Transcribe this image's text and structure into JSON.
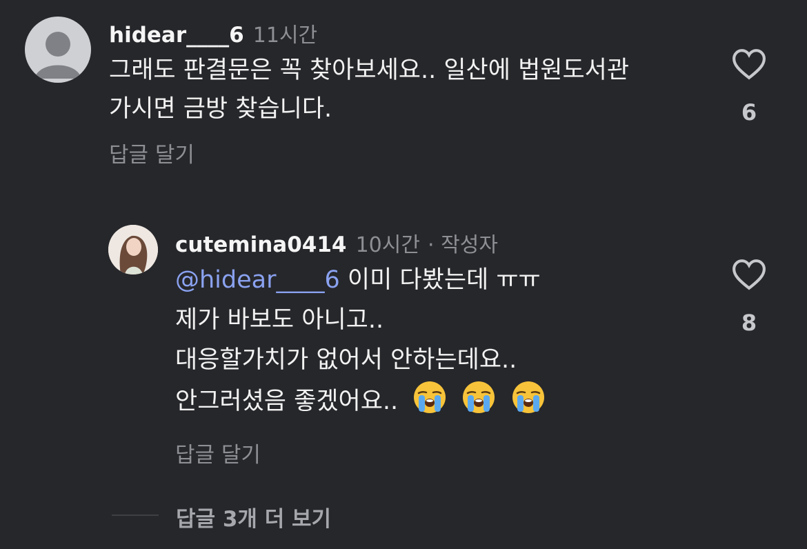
{
  "comments": [
    {
      "username": "hidear____6",
      "time": "11시간",
      "lines": [
        "그래도 판결문은 꼭 찾아보세요.. 일산에 법원도서관",
        "가시면 금방 찾습니다."
      ],
      "reply_label": "답글 달기",
      "likes": "6"
    },
    {
      "username": "cutemina0414",
      "time": "10시간",
      "author_badge": "· 작성자",
      "mention": "@hidear____6",
      "lines": [
        "이미 다봤는데 ㅠㅠ",
        "제가 바보도 아니고..",
        "대응할가치가 없어서 안하는데요..",
        "안그러셨음 좋겠어요.."
      ],
      "reply_label": "답글 달기",
      "likes": "8"
    }
  ],
  "more_replies": "답글 3개 더 보기",
  "icons": {
    "like": "heart-outline-icon",
    "emoji": "loudly-crying-face-icon",
    "avatar_default": "default-user-avatar-icon"
  },
  "colors": {
    "background": "#26272b",
    "text": "#f2f2f2",
    "muted": "#8e8f94",
    "mention": "#8aa2f0"
  }
}
